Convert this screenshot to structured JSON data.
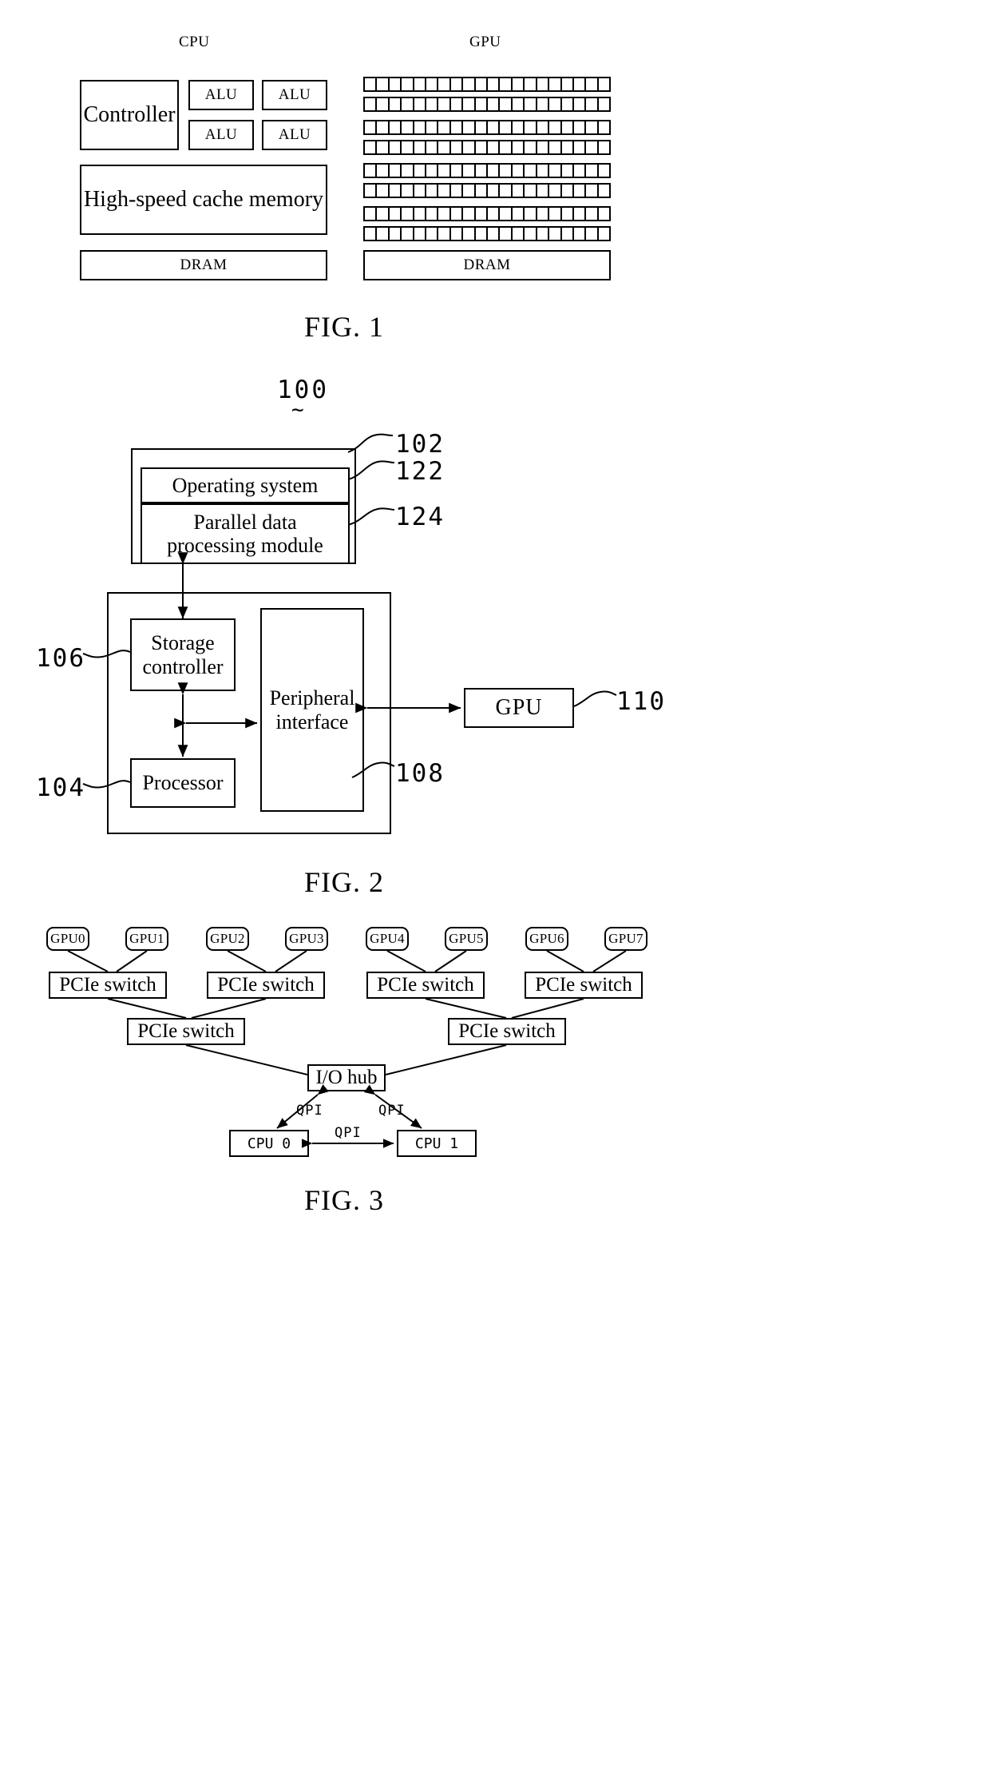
{
  "figures": [
    {
      "id": "fig1",
      "caption": "FIG. 1",
      "cpu": {
        "header": "CPU",
        "controller": "Controller",
        "alus": [
          "ALU",
          "ALU",
          "ALU",
          "ALU"
        ],
        "cache": "High-speed cache memory",
        "dram": "DRAM"
      },
      "gpu": {
        "header": "GPU",
        "dram": "DRAM",
        "grid_rows": 8,
        "grid_cols": 20
      }
    },
    {
      "id": "fig2",
      "caption": "FIG. 2",
      "system_ref": "100",
      "memory_ref": "102",
      "os_ref": "122",
      "module_ref": "124",
      "storage_ref": "106",
      "processor_ref": "104",
      "peripheral_ref": "108",
      "gpu_ref": "110",
      "operating_system": "Operating system",
      "parallel_module_line1": "Parallel data",
      "parallel_module_line2": "processing module",
      "storage_line1": "Storage",
      "storage_line2": "controller",
      "processor": "Processor",
      "peripheral_line1": "Peripheral",
      "peripheral_line2": "interface",
      "gpu": "GPU"
    },
    {
      "id": "fig3",
      "caption": "FIG. 3",
      "gpus": [
        "GPU0",
        "GPU1",
        "GPU2",
        "GPU3",
        "GPU4",
        "GPU5",
        "GPU6",
        "GPU7"
      ],
      "pcie_switches_top": [
        "PCIe switch",
        "PCIe switch",
        "PCIe switch",
        "PCIe switch"
      ],
      "pcie_switches_mid": [
        "PCIe switch",
        "PCIe switch"
      ],
      "io_hub": "I/O hub",
      "cpus": [
        "CPU 0",
        "CPU 1"
      ],
      "qpi_labels": [
        "QPI",
        "QPI",
        "QPI"
      ]
    }
  ],
  "colors": {
    "line": "#000000",
    "background": "#ffffff"
  }
}
